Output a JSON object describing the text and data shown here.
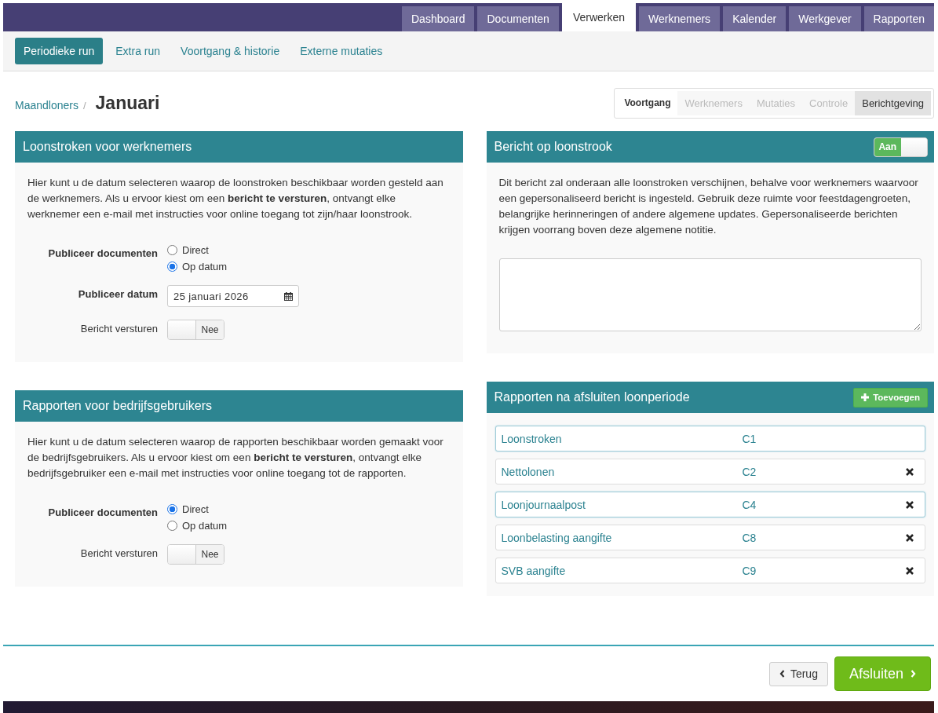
{
  "main_tabs": [
    {
      "label": "Dashboard",
      "selected": false
    },
    {
      "label": "Documenten",
      "selected": false
    },
    {
      "label": "Verwerken",
      "selected": true
    },
    {
      "label": "Werknemers",
      "selected": false
    },
    {
      "label": "Kalender",
      "selected": false
    },
    {
      "label": "Werkgever",
      "selected": false
    },
    {
      "label": "Rapporten",
      "selected": false
    }
  ],
  "sub_tabs": [
    {
      "label": "Periodieke run",
      "selected": true
    },
    {
      "label": "Extra run",
      "selected": false
    },
    {
      "label": "Voortgang & historie",
      "selected": false
    },
    {
      "label": "Externe mutaties",
      "selected": false
    }
  ],
  "breadcrumb": {
    "parent": "Maandloners",
    "separator": "/",
    "current": "Januari"
  },
  "steps": [
    {
      "label": "Voortgang",
      "selected": false,
      "disabled": false
    },
    {
      "label": "Werknemers",
      "selected": false,
      "disabled": true
    },
    {
      "label": "Mutaties",
      "selected": false,
      "disabled": true
    },
    {
      "label": "Controle",
      "selected": false,
      "disabled": true
    },
    {
      "label": "Berichtgeving",
      "selected": true,
      "disabled": false
    }
  ],
  "left_panels": [
    {
      "title": "Loonstroken voor werknemers",
      "description": "Hier kunt u de datum selecteren waarop de loonstroken beschikbaar worden gesteld aan de werknemers. Als u ervoor kiest om een **bericht te versturen**, ontvangt elke werknemer een e-mail met instructies voor online toegang tot zijn/haar loonstrook.",
      "fields": [
        {
          "kind": "radio",
          "label": "Publiceer documenten",
          "options": [
            {
              "label": "Direct",
              "selected": false
            },
            {
              "label": "Op datum",
              "selected": true
            }
          ]
        },
        {
          "kind": "date",
          "label": "Publiceer datum",
          "value": "25 januari 2026"
        },
        {
          "kind": "toggle",
          "label": "Bericht versturen",
          "on": false,
          "toggle_label": "Nee"
        }
      ]
    },
    {
      "title": "Rapporten voor bedrijfsgebruikers",
      "description": "Hier kunt u de datum selecteren waarop de rapporten beschikbaar worden gemaakt voor de bedrijfsgebruikers. Als u ervoor kiest om een **bericht te versturen**, ontvangt elke bedrijfsgebruiker een e-mail met instructies voor online toegang tot de rapporten.",
      "fields": [
        {
          "kind": "radio",
          "label": "Publiceer documenten",
          "options": [
            {
              "label": "Direct",
              "selected": true
            },
            {
              "label": "Op datum",
              "selected": false
            }
          ]
        },
        {
          "kind": "toggle",
          "label": "Bericht versturen",
          "on": false,
          "toggle_label": "Nee"
        }
      ]
    }
  ],
  "message_panel": {
    "title": "Bericht op loonstrook",
    "toggle": {
      "on": true,
      "label": "Aan"
    },
    "description": "Dit bericht zal onderaan alle loonstroken verschijnen, behalve voor werknemers waarvoor een gepersonaliseerd bericht is ingesteld. Gebruik deze ruimte voor feestdagengroeten, belangrijke herinneringen of andere algemene updates. Gepersonaliseerde berichten krijgen voorrang boven deze algemene notitie."
  },
  "reports_panel": {
    "title": "Rapporten na afsluiten loonperiode",
    "add_button": "Toevoegen",
    "reports": [
      {
        "name": "Loonstroken",
        "code": "C1",
        "highlighted": true,
        "removable": false
      },
      {
        "name": "Nettolonen",
        "code": "C2",
        "highlighted": false,
        "removable": true
      },
      {
        "name": "Loonjournaalpost",
        "code": "C4",
        "highlighted": true,
        "removable": true
      },
      {
        "name": "Loonbelasting aangifte",
        "code": "C8",
        "highlighted": false,
        "removable": true
      },
      {
        "name": "SVB aangifte",
        "code": "C9",
        "highlighted": false,
        "removable": true
      }
    ]
  },
  "footer": {
    "back_button": "Terug",
    "finish_button": "Afsluiten"
  }
}
